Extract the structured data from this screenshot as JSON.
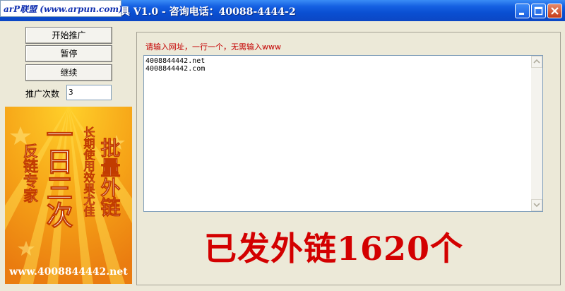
{
  "window": {
    "title": "具 V1.0 - 咨询电话：40088-4444-2",
    "watermark": "arP联盟 (www.arpun.com)"
  },
  "buttons": {
    "start": "开始推广",
    "pause": "暂停",
    "continue": "继续"
  },
  "count": {
    "label": "推广次数",
    "value": "3"
  },
  "banner": {
    "col1": "反链专家",
    "col2": "一日三次",
    "col3": "长期使用效果尤佳",
    "col4": "批量外链",
    "url": "www.4008844442.net"
  },
  "main": {
    "hint": "请输入网址，一行一个，无需输入www",
    "lines": [
      "4008844442.net",
      "4008844442.com"
    ],
    "status": "已发外链1620个"
  },
  "colors": {
    "titlebar": "#0b47c4",
    "hint": "#c40000",
    "status": "#d30000",
    "banner_bg": "#f39a16"
  }
}
